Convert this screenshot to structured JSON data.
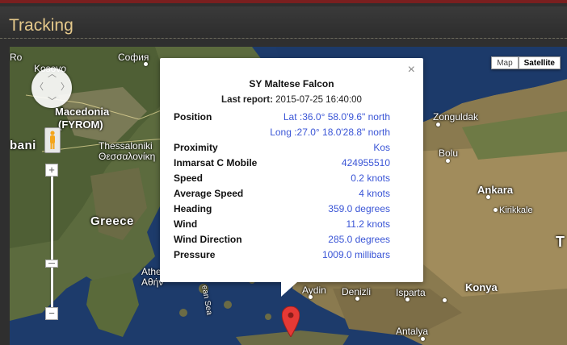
{
  "header": {
    "title": "Tracking"
  },
  "map": {
    "type_buttons": [
      {
        "label": "Map",
        "selected": false
      },
      {
        "label": "Satellite",
        "selected": true
      }
    ],
    "labels": {
      "sofia": "София",
      "kosovo": "Kosovo",
      "macedonia": "Macedonia",
      "fyrom": "(FYROM)",
      "albania": "bani",
      "thessaloniki_en": "Thessaloniki",
      "thessaloniki_gr": "Θεσσαλονίκη",
      "greece": "Greece",
      "athens_en": "Athe",
      "athens_gr": "Αθήν",
      "aegean": "ean Sea",
      "aydin": "Aydin",
      "denizli": "Denizli",
      "isparta": "Isparta",
      "konya": "Konya",
      "antalya": "Antalya",
      "zonguldak": "Zonguldak",
      "bolu": "Bolu",
      "ankara": "Ankara",
      "kirikkale": "Kirikkale",
      "turkey_t": "T",
      "roi": "Ro"
    },
    "zoom": {
      "plus": "+",
      "minus": "−"
    }
  },
  "popup": {
    "close": "×",
    "title": "SY Maltese Falcon",
    "report_label": "Last report:",
    "report_value": "2015-07-25 16:40:00",
    "rows": [
      {
        "key": "Position",
        "value": "Lat :36.0° 58.0'9.6\" north"
      },
      {
        "key": "",
        "value": "Long :27.0° 18.0'28.8\" north"
      },
      {
        "key": "Proximity",
        "value": "Kos"
      },
      {
        "key": "Inmarsat C Mobile",
        "value": "424955510"
      },
      {
        "key": "Speed",
        "value": "0.2 knots"
      },
      {
        "key": "Average Speed",
        "value": "4 knots"
      },
      {
        "key": "Heading",
        "value": "359.0 degrees"
      },
      {
        "key": "Wind",
        "value": "11.2 knots"
      },
      {
        "key": "Wind Direction",
        "value": "285.0 degrees"
      },
      {
        "key": "Pressure",
        "value": "1009.0 millibars"
      }
    ]
  },
  "colors": {
    "title": "#e5c98b",
    "link": "#3a55d6",
    "marker": "#e53935"
  }
}
